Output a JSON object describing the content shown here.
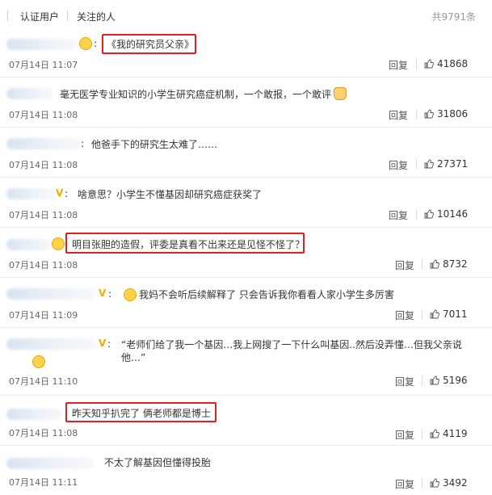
{
  "tabs": {
    "items": [
      {
        "label": "认证用户"
      },
      {
        "label": "关注的人"
      }
    ],
    "total": "共9791条"
  },
  "reply_label": "回复",
  "comments": [
    {
      "text": "《我的研究员父亲》",
      "time": "07月14日 11:07",
      "likes": "41868"
    },
    {
      "text": "毫无医学专业知识的小学生研究癌症机制，一个敢报，一个敢评",
      "time": "07月14日 11:08",
      "likes": "31806"
    },
    {
      "text": "他爸手下的研究生太难了……",
      "time": "07月14日 11:08",
      "likes": "27371"
    },
    {
      "text": "啥意思？小学生不懂基因却研究癌症获奖了",
      "time": "07月14日 11:08",
      "likes": "10146"
    },
    {
      "text": "明目张胆的造假，评委是真看不出来还是见怪不怪了？",
      "time": "07月14日 11:08",
      "likes": "8732"
    },
    {
      "text": "我妈不会听后续解释了 只会告诉我你看看人家小学生多厉害",
      "time": "07月14日 11:09",
      "likes": "7011"
    },
    {
      "text": "“老师们给了我一个基因…我上网搜了一下什么叫基因..然后没弄懂…但我父亲说他…”",
      "time": "07月14日 11:10",
      "likes": "5196"
    },
    {
      "text": "昨天知乎扒完了 俩老师都是博士",
      "time": "07月14日 11:08",
      "likes": "4119"
    },
    {
      "text": "不太了解基因但懂得投胎",
      "time": "07月14日 11:11",
      "likes": "3492"
    }
  ],
  "colors": {
    "highlight": "#e02020",
    "badge": "#f6a800",
    "divider": "#ececec"
  }
}
